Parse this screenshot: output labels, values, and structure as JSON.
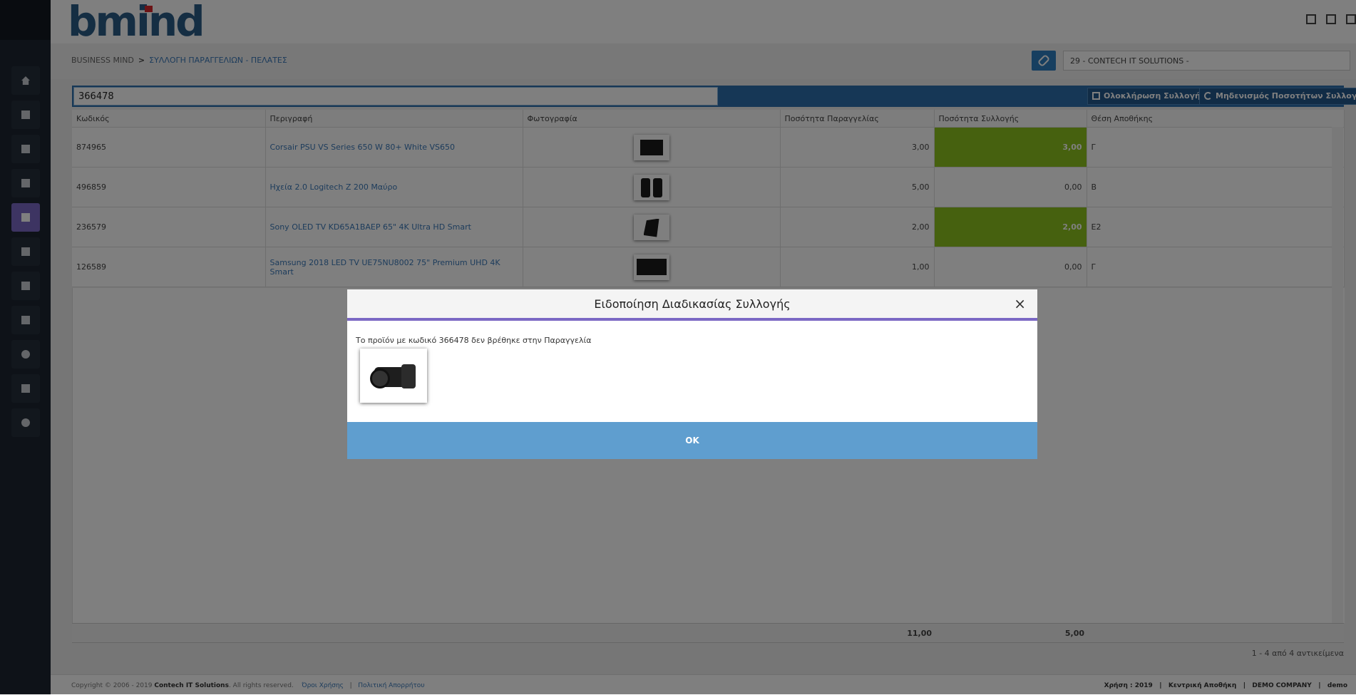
{
  "app": {
    "logo_text": "bmind",
    "breadcrumb": [
      "BUSINESS MIND",
      "ΣΥΛΛΟΓΗ ΠΑΡΑΓΓΕΛΙΩΝ - ΠΕΛΑΤΕΣ"
    ],
    "breadcrumb_sep": ">",
    "customer_value": "29 - CONTECH IT SOLUTIONS -",
    "header_icons": [
      "lock-icon",
      "fullscreen-icon",
      "menu-icon"
    ]
  },
  "sidebar": {
    "items": [
      {
        "icon": "home-icon"
      },
      {
        "icon": "contact-card-icon"
      },
      {
        "icon": "address-book-icon"
      },
      {
        "icon": "archive-icon"
      },
      {
        "icon": "document-icon",
        "active": true
      },
      {
        "icon": "calendar-icon"
      },
      {
        "icon": "phone-icon"
      },
      {
        "icon": "wrench-icon"
      },
      {
        "icon": "gear-icon"
      },
      {
        "icon": "print-icon"
      },
      {
        "icon": "globe-icon"
      }
    ]
  },
  "toolbar": {
    "search_value": "366478",
    "complete_label": "Ολοκλήρωση Συλλογής",
    "reset_label": "Μηδενισμός Ποσοτήτων Συλλογής"
  },
  "table": {
    "columns": [
      "Κωδικός",
      "Περιγραφή",
      "Φωτογραφία",
      "Ποσότητα Παραγγελίας",
      "Ποσότητα Συλλογής",
      "Θέση Αποθήκης"
    ],
    "rows": [
      {
        "code": "874965",
        "description": "Corsair PSU VS Series 650 W 80+ White VS650",
        "photo": "psu",
        "order_qty": "3,00",
        "collected_qty": "3,00",
        "collected_complete": true,
        "location": "Γ"
      },
      {
        "code": "496859",
        "description": "Ηχεία 2.0 Logitech Z 200 Μαύρο",
        "photo": "speakers",
        "order_qty": "5,00",
        "collected_qty": "0,00",
        "collected_complete": false,
        "location": "Β"
      },
      {
        "code": "236579",
        "description": "Sony OLED TV KD65A1BAEP 65\" 4K Ultra HD Smart",
        "photo": "tv-angle",
        "order_qty": "2,00",
        "collected_qty": "2,00",
        "collected_complete": true,
        "location": "Ε2"
      },
      {
        "code": "126589",
        "description": "Samsung 2018 LED TV UE75NU8002 75\" Premium UHD 4K Smart",
        "photo": "tv-front",
        "order_qty": "1,00",
        "collected_qty": "0,00",
        "collected_complete": false,
        "location": "Γ"
      }
    ],
    "totals": {
      "order_qty": "11,00",
      "collected_qty": "5,00"
    },
    "pager_text": "1 - 4 από 4 αντικείμενα"
  },
  "footer": {
    "copyright_prefix": "Copyright © 2006 - 2019",
    "company": "Contech IT Solutions",
    "rights": ". All rights reserved.",
    "terms": "Όροι Χρήσης",
    "privacy": "Πολιτική Απορρήτου",
    "year": "Χρήση : 2019",
    "warehouse": "Κεντρική Αποθήκη",
    "company_name": "DEMO COMPANY",
    "user": "demo",
    "sep": "|"
  },
  "modal": {
    "title": "Ειδοποίηση Διαδικασίας Συλλογής",
    "message": "Το προϊόν με κωδικό 366478 δεν βρέθηκε στην Παραγγελία",
    "image": "camera",
    "ok_label": "OK",
    "close_symbol": "×"
  },
  "colors": {
    "accent": "#7b68c4",
    "toolbar_blue": "#2c6fad",
    "collected_green": "#8dc21f",
    "ok_button": "#5f9ecf"
  }
}
